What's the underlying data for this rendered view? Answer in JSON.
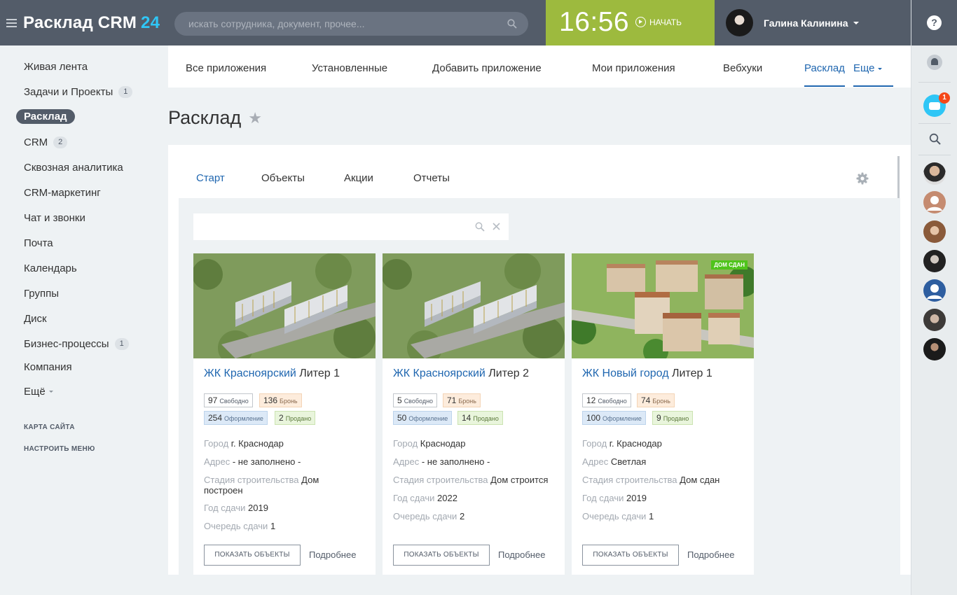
{
  "header": {
    "logo": "Расклад CRM",
    "logo_number": "24",
    "search_placeholder": "искать сотрудника, документ, прочее...",
    "time": "16:56",
    "start_label": "НАЧАТЬ",
    "user_name": "Галина Калинина"
  },
  "rightbar": {
    "help": "?",
    "bot_count": "1"
  },
  "menu": {
    "items": [
      {
        "label": "Живая лента"
      },
      {
        "label": "Задачи и Проекты",
        "badge": "1"
      },
      {
        "label": "Расклад"
      },
      {
        "label": "CRM",
        "badge": "2"
      },
      {
        "label": "Сквозная аналитика"
      },
      {
        "label": "CRM-маркетинг"
      },
      {
        "label": "Чат и звонки"
      },
      {
        "label": "Почта"
      },
      {
        "label": "Календарь"
      },
      {
        "label": "Группы"
      },
      {
        "label": "Диск"
      },
      {
        "label": "Бизнес-процессы",
        "badge": "1"
      },
      {
        "label": "Компания"
      },
      {
        "label": "Ещё"
      }
    ],
    "sitemap": "КАРТА САЙТА",
    "configure": "НАСТРОИТЬ МЕНЮ"
  },
  "topnav": [
    "Все приложения",
    "Установленные",
    "Добавить приложение",
    "Мои приложения",
    "Вебхуки",
    "Расклад",
    "Еще"
  ],
  "page_title": "Расклад",
  "tabs": [
    "Старт",
    "Объекты",
    "Акции",
    "Отчеты"
  ],
  "cards": [
    {
      "name_link": "ЖК Красноярский",
      "name_rest": " Литер 1",
      "free": "97",
      "free_label": "Свободно",
      "bron": "136",
      "bron_label": "Бронь",
      "oform": "254",
      "oform_label": "Оформление",
      "sold": "2",
      "sold_label": "Продано",
      "city_k": "Город",
      "city": "г. Краснодар",
      "addr_k": "Адрес",
      "addr": "- не заполнено -",
      "stage_k": "Стадия строительства",
      "stage": "Дом построен",
      "year_k": "Год сдачи",
      "year": "2019",
      "queue_k": "Очередь сдачи",
      "queue": "1",
      "show": "ПОКАЗАТЬ ОБЪЕКТЫ",
      "more": "Подробнее"
    },
    {
      "name_link": "ЖК Красноярский",
      "name_rest": " Литер 2",
      "free": "5",
      "free_label": "Свободно",
      "bron": "71",
      "bron_label": "Бронь",
      "oform": "50",
      "oform_label": "Оформление",
      "sold": "14",
      "sold_label": "Продано",
      "city_k": "Город",
      "city": "Краснодар",
      "addr_k": "Адрес",
      "addr": "- не заполнено -",
      "stage_k": "Стадия строительства",
      "stage": "Дом строится",
      "year_k": "Год сдачи",
      "year": "2022",
      "queue_k": "Очередь сдачи",
      "queue": "2",
      "show": "ПОКАЗАТЬ ОБЪЕКТЫ",
      "more": "Подробнее"
    },
    {
      "name_link": "ЖК Новый город",
      "name_rest": " Литер 1",
      "badge": "ДОМ СДАН",
      "free": "12",
      "free_label": "Свободно",
      "bron": "74",
      "bron_label": "Бронь",
      "oform": "100",
      "oform_label": "Оформление",
      "sold": "9",
      "sold_label": "Продано",
      "city_k": "Город",
      "city": "г. Краснодар",
      "addr_k": "Адрес",
      "addr": "Светлая",
      "stage_k": "Стадия строительства",
      "stage": "Дом сдан",
      "year_k": "Год сдачи",
      "year": "2019",
      "queue_k": "Очередь сдачи",
      "queue": "1",
      "show": "ПОКАЗАТЬ ОБЪЕКТЫ",
      "more": "Подробнее"
    }
  ]
}
